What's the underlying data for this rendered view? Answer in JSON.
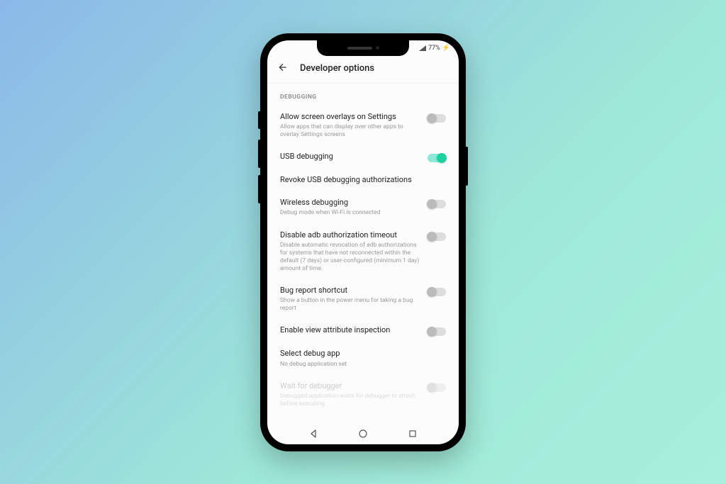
{
  "status_bar": {
    "battery_text": "77%",
    "charging_glyph": "⚡"
  },
  "header": {
    "title": "Developer options"
  },
  "section_header": "DEBUGGING",
  "settings": [
    {
      "title": "Allow screen overlays on Settings",
      "subtitle": "Allow apps that can display over other apps to overlay Settings screens",
      "toggle": true,
      "toggle_on": false,
      "disabled": false
    },
    {
      "title": "USB debugging",
      "subtitle": "",
      "toggle": true,
      "toggle_on": true,
      "disabled": false
    },
    {
      "title": "Revoke USB debugging authorizations",
      "subtitle": "",
      "toggle": false,
      "toggle_on": false,
      "disabled": false
    },
    {
      "title": "Wireless debugging",
      "subtitle": "Debug mode when Wi-Fi is connected",
      "toggle": true,
      "toggle_on": false,
      "disabled": false
    },
    {
      "title": "Disable adb authorization timeout",
      "subtitle": "Disable automatic revocation of adb authorizations for systems that have not reconnected within the default (7 days) or user-configured (minimum 1 day) amount of time.",
      "toggle": true,
      "toggle_on": false,
      "disabled": false
    },
    {
      "title": "Bug report shortcut",
      "subtitle": "Show a button in the power menu for taking a bug report",
      "toggle": true,
      "toggle_on": false,
      "disabled": false
    },
    {
      "title": "Enable view attribute inspection",
      "subtitle": "",
      "toggle": true,
      "toggle_on": false,
      "disabled": false
    },
    {
      "title": "Select debug app",
      "subtitle": "No debug application set",
      "toggle": false,
      "toggle_on": false,
      "disabled": false
    },
    {
      "title": "Wait for debugger",
      "subtitle": "Debugged application waits for debugger to attach before executing",
      "toggle": true,
      "toggle_on": false,
      "disabled": true
    }
  ]
}
